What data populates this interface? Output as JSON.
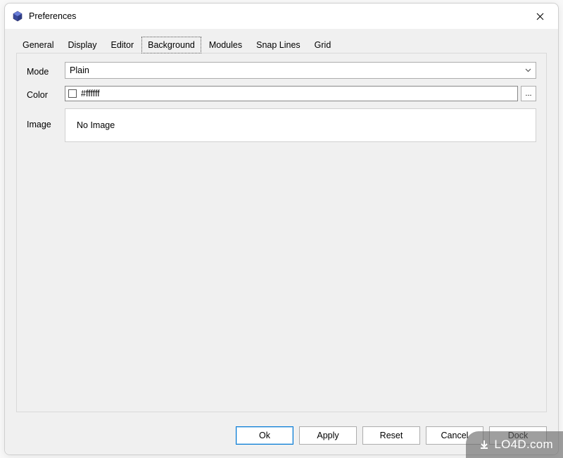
{
  "window": {
    "title": "Preferences"
  },
  "tabs": [
    {
      "label": "General",
      "active": false
    },
    {
      "label": "Display",
      "active": false
    },
    {
      "label": "Editor",
      "active": false
    },
    {
      "label": "Background",
      "active": true
    },
    {
      "label": "Modules",
      "active": false
    },
    {
      "label": "Snap Lines",
      "active": false
    },
    {
      "label": "Grid",
      "active": false
    }
  ],
  "form": {
    "mode": {
      "label": "Mode",
      "value": "Plain"
    },
    "color": {
      "label": "Color",
      "value": "#ffffff",
      "swatch": "#ffffff",
      "browse": "..."
    },
    "image": {
      "label": "Image",
      "value": "No Image"
    }
  },
  "buttons": {
    "ok": "Ok",
    "apply": "Apply",
    "reset": "Reset",
    "cancel": "Cancel",
    "dock": "Dock"
  },
  "watermark": "LO4D.com"
}
